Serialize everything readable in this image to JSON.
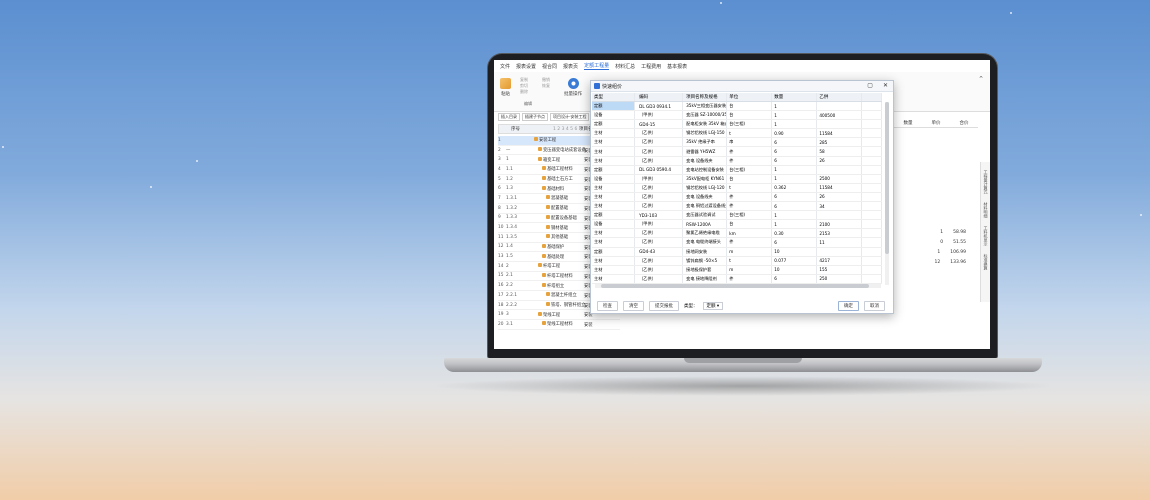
{
  "menu": [
    "文件",
    "报表设置",
    "视合同",
    "报表页",
    "定额工程量",
    "材料汇总",
    "工程费用",
    "基本报表"
  ],
  "menu_active": "定额工程量",
  "ribbon": {
    "paste_label": "粘贴",
    "copy_label": "复制",
    "cut_label": "剪切",
    "delete_label": "删除",
    "undo_label": "撤销",
    "redo_label": "恢复",
    "edit_group": "编辑",
    "batch_label": "批量操作"
  },
  "toolbar2": [
    "插入目录",
    "插建子节点",
    "项目设计-安装工程"
  ],
  "tree": {
    "header_no": "序号",
    "header_name": "项目名称",
    "rows": [
      {
        "n": "1",
        "code": "",
        "name": "安装工程",
        "sel": true
      },
      {
        "n": "2",
        "code": "一",
        "name": "变压器变电站成套设备",
        "tag": "安装"
      },
      {
        "n": "3",
        "code": "1",
        "name": "箱变工程",
        "tag": "安装"
      },
      {
        "n": "4",
        "code": "1.1",
        "name": "基础工程材料",
        "tag": "安装"
      },
      {
        "n": "5",
        "code": "1.2",
        "name": "基础土石方工",
        "tag": "安装"
      },
      {
        "n": "6",
        "code": "1.3",
        "name": "基础材料",
        "tag": "安装"
      },
      {
        "n": "7",
        "code": "1.3.1",
        "name": "混凝基础",
        "tag": "安装"
      },
      {
        "n": "8",
        "code": "1.3.2",
        "name": "配置基础",
        "tag": "安装"
      },
      {
        "n": "9",
        "code": "1.3.3",
        "name": "配置设备基础",
        "tag": "安装"
      },
      {
        "n": "10",
        "code": "1.3.4",
        "name": "钢材基础",
        "tag": "安装"
      },
      {
        "n": "11",
        "code": "1.3.5",
        "name": "其他基础",
        "tag": "安装"
      },
      {
        "n": "12",
        "code": "1.4",
        "name": "基础保护",
        "tag": "安装"
      },
      {
        "n": "13",
        "code": "1.5",
        "name": "基础处理",
        "tag": "安装"
      },
      {
        "n": "14",
        "code": "2",
        "name": "杆塔工程",
        "tag": "安装"
      },
      {
        "n": "15",
        "code": "2.1",
        "name": "杆塔工程材料",
        "tag": "安装"
      },
      {
        "n": "16",
        "code": "2.2",
        "name": "杆塔组立",
        "tag": "安装"
      },
      {
        "n": "17",
        "code": "2.2.1",
        "name": "混凝土杆组立",
        "tag": "安装"
      },
      {
        "n": "18",
        "code": "2.2.2",
        "name": "铁塔、钢管杆组立",
        "tag": "安装"
      },
      {
        "n": "19",
        "code": "3",
        "name": "架线工程",
        "tag": "安装"
      },
      {
        "n": "20",
        "code": "3.1",
        "name": "架线工程材料",
        "tag": "安装"
      }
    ]
  },
  "right": {
    "headers": [
      "数量",
      "单价",
      "合价"
    ],
    "rows": [
      {
        "qty": "1",
        "price": "58.98"
      },
      {
        "qty": "0",
        "price": "51.55"
      },
      {
        "qty": "1",
        "price": "106.99"
      },
      {
        "qty": "12",
        "price": "133.96"
      }
    ],
    "vtabs": [
      "工程量计算式",
      "材料明细",
      "工料机显示",
      "标准换算"
    ]
  },
  "dialog": {
    "title": "快速组价",
    "columns": [
      "类型",
      "编码",
      "项目名称及规格",
      "单位",
      "数量",
      "乙供"
    ],
    "rows": [
      {
        "t": "定额",
        "c": "DL GD3 0934.1",
        "n": "35kV三相变压器安装",
        "u": "台",
        "q": "1",
        "y": "",
        "sel": true
      },
      {
        "t": "设备",
        "c": "（甲供）",
        "n": "变压器 SZ-10000/35",
        "u": "台",
        "q": "1",
        "y": "400500"
      },
      {
        "t": "定额",
        "c": "GD4-15",
        "n": "配电柜安装 35kV 箱式",
        "u": "台(三相)",
        "q": "1",
        "y": ""
      },
      {
        "t": "主材",
        "c": "（乙供）",
        "n": "钢芯铝绞线 LGJ-150",
        "u": "t",
        "q": "0.90",
        "y": "11584"
      },
      {
        "t": "主材",
        "c": "（乙供）",
        "n": "35kV 绝缘子串",
        "u": "串",
        "q": "6",
        "y": "285"
      },
      {
        "t": "主材",
        "c": "（乙供）",
        "n": "避雷器 YH5WZ",
        "u": "件",
        "q": "6",
        "y": "58"
      },
      {
        "t": "主材",
        "c": "（乙供）",
        "n": "变电 设备线夹",
        "u": "件",
        "q": "6",
        "y": "26"
      },
      {
        "t": "定额",
        "c": "DL GD3 0590.4",
        "n": "变电站控制设备安装",
        "u": "台(三相)",
        "q": "1",
        "y": ""
      },
      {
        "t": "设备",
        "c": "（甲供）",
        "n": "35kV配电柜 KYN61",
        "u": "台",
        "q": "1",
        "y": "2500"
      },
      {
        "t": "主材",
        "c": "（乙供）",
        "n": "钢芯铝绞线 LGJ-120",
        "u": "t",
        "q": "0.362",
        "y": "11584"
      },
      {
        "t": "主材",
        "c": "（乙供）",
        "n": "变电 设备线夹",
        "u": "件",
        "q": "6",
        "y": "26"
      },
      {
        "t": "主材",
        "c": "（乙供）",
        "n": "变电 铜铝过渡设备线夹",
        "u": "件",
        "q": "6",
        "y": "34"
      },
      {
        "t": "定额",
        "c": "YD3-103",
        "n": "变压器试验调试",
        "u": "台(三相)",
        "q": "1",
        "y": ""
      },
      {
        "t": "设备",
        "c": "（甲供）",
        "n": "RSW-1200A",
        "u": "台",
        "q": "1",
        "y": "2100"
      },
      {
        "t": "主材",
        "c": "（乙供）",
        "n": "聚氯乙烯绝缘电缆",
        "u": "km",
        "q": "0.30",
        "y": "2153"
      },
      {
        "t": "主材",
        "c": "（乙供）",
        "n": "变电 电缆终端接头",
        "u": "件",
        "q": "6",
        "y": "11"
      },
      {
        "t": "定额",
        "c": "GD4-43",
        "n": "接地网安装",
        "u": "m",
        "q": "10",
        "y": ""
      },
      {
        "t": "主材",
        "c": "（乙供）",
        "n": "镀锌扁钢 -50×5",
        "u": "t",
        "q": "0.077",
        "y": "4217"
      },
      {
        "t": "主材",
        "c": "（乙供）",
        "n": "接地极保护套",
        "u": "m",
        "q": "10",
        "y": "155"
      },
      {
        "t": "主材",
        "c": "（乙供）",
        "n": "变电 接地降阻剂",
        "u": "件",
        "q": "6",
        "y": "250"
      }
    ],
    "footer": {
      "check_all": "检查",
      "clear": "清空",
      "submit_label": "提交报批",
      "source_label": "类型：",
      "source_value": "定额",
      "ok": "确定",
      "cancel": "取消"
    }
  }
}
